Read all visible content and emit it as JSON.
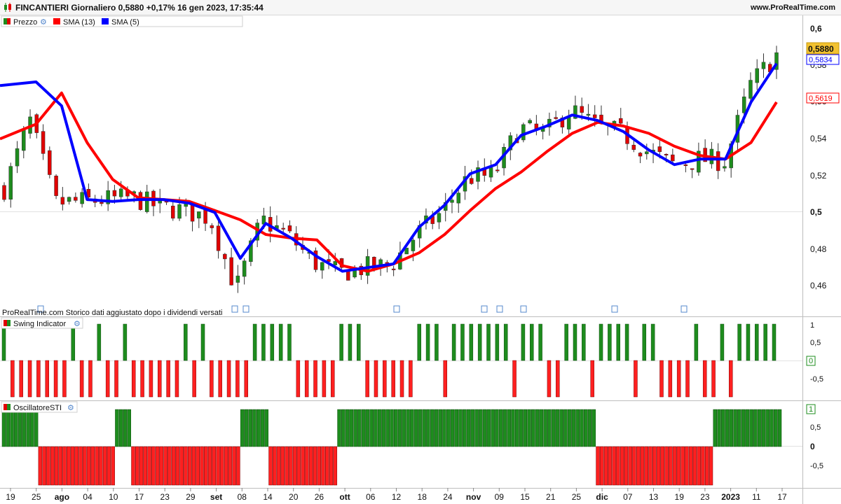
{
  "header": {
    "title": "FINCANTIERI Giornaliero 0,5880 +0,17% 16 gen 2023, 17:35:44",
    "site": "www.ProRealTime.com"
  },
  "notice": "ProRealTime.com  Storico dati aggiustato dopo i dividendi versati",
  "panels": {
    "price": {
      "legend": [
        {
          "label": "Prezzo",
          "color": "#1e8c1e",
          "has_wrench": true
        },
        {
          "label": "SMA (13)",
          "color": "#ff0000"
        },
        {
          "label": "SMA (5)",
          "color": "#0000ff"
        }
      ],
      "y_ticks": [
        "0,6",
        "0,58",
        "0,56",
        "0,54",
        "0,52",
        "0,5",
        "0,48",
        "0,46"
      ],
      "badges": [
        {
          "value": "0,5880",
          "style": "gold"
        },
        {
          "value": "0,5834",
          "style": "blue"
        },
        {
          "value": "0,5619",
          "style": "red"
        }
      ]
    },
    "swing": {
      "legend": "Swing Indicator",
      "y_ticks": [
        "1",
        "0,5",
        "0",
        "-0,5"
      ]
    },
    "sti": {
      "legend": "OscillatoreSTI",
      "y_ticks": [
        "1",
        "0,5",
        "0",
        "-0,5"
      ]
    }
  },
  "x_axis": {
    "labels": [
      "19",
      "25",
      "ago",
      "04",
      "10",
      "17",
      "23",
      "29",
      "set",
      "08",
      "14",
      "20",
      "26",
      "ott",
      "06",
      "12",
      "18",
      "24",
      "nov",
      "09",
      "15",
      "21",
      "25",
      "dic",
      "07",
      "13",
      "19",
      "23",
      "2023",
      "11",
      "17"
    ]
  },
  "chart_data": [
    {
      "type": "candlestick",
      "title": "FINCANTIERI Giornaliero",
      "categories": [
        "19",
        "25",
        "ago",
        "04",
        "10",
        "17",
        "23",
        "29",
        "set",
        "08",
        "14",
        "20",
        "26",
        "ott",
        "06",
        "12",
        "18",
        "24",
        "nov",
        "09",
        "15",
        "21",
        "25",
        "dic",
        "07",
        "13",
        "19",
        "23",
        "2023",
        "11",
        "17"
      ],
      "close_path": [
        0.515,
        0.552,
        0.507,
        0.508,
        0.509,
        0.51,
        0.505,
        0.503,
        0.499,
        0.46,
        0.498,
        0.49,
        0.475,
        0.469,
        0.472,
        0.473,
        0.49,
        0.502,
        0.521,
        0.522,
        0.548,
        0.545,
        0.558,
        0.549,
        0.545,
        0.535,
        0.528,
        0.531,
        0.53,
        0.572,
        0.588
      ],
      "ylim": [
        0.45,
        0.605
      ],
      "grid_lines": [
        0.5
      ],
      "last_price": 0.588,
      "series": [
        {
          "name": "SMA (13)",
          "last": 0.5619,
          "values": [
            0.542,
            0.55,
            0.567,
            0.54,
            0.52,
            0.51,
            0.509,
            0.508,
            0.503,
            0.498,
            0.49,
            0.488,
            0.487,
            0.473,
            0.47,
            0.474,
            0.48,
            0.49,
            0.503,
            0.515,
            0.524,
            0.535,
            0.545,
            0.551,
            0.549,
            0.545,
            0.538,
            0.533,
            0.531,
            0.54,
            0.562
          ]
        },
        {
          "name": "SMA (5)",
          "last": 0.5834,
          "values": [
            0.571,
            0.573,
            0.56,
            0.509,
            0.508,
            0.509,
            0.509,
            0.507,
            0.502,
            0.477,
            0.496,
            0.488,
            0.478,
            0.47,
            0.472,
            0.474,
            0.494,
            0.506,
            0.523,
            0.528,
            0.544,
            0.549,
            0.555,
            0.552,
            0.546,
            0.536,
            0.528,
            0.531,
            0.531,
            0.562,
            0.583
          ]
        }
      ]
    },
    {
      "type": "bar",
      "title": "Swing Indicator",
      "ylim": [
        -1,
        1
      ],
      "signs": "+-------+--+--+------+-+-----+++++-----+++------+++-+++++++-+++--+++-++++-++----+--+-+++++"
    },
    {
      "type": "bar",
      "title": "OscillatoreSTI",
      "ylim": [
        -1,
        1
      ],
      "runs": [
        {
          "value": 1,
          "count": 9
        },
        {
          "value": -1,
          "count": 19
        },
        {
          "value": 1,
          "count": 4
        },
        {
          "value": -1,
          "count": 27
        },
        {
          "value": 1,
          "count": 7
        },
        {
          "value": -1,
          "count": 17
        },
        {
          "value": 1,
          "count": 64
        },
        {
          "value": -1,
          "count": 29
        },
        {
          "value": 1,
          "count": 17
        }
      ]
    }
  ]
}
